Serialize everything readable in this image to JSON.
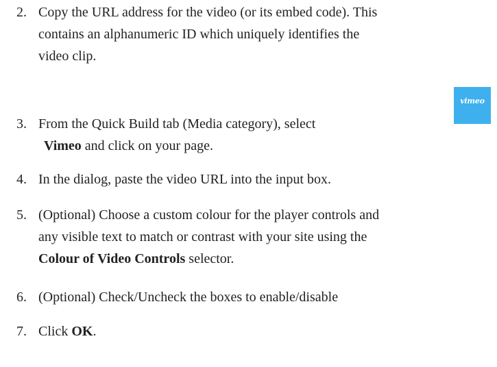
{
  "steps": [
    {
      "number": "2.",
      "lines": [
        "Copy the URL address for the video (or its embed code). This",
        "contains an alphanumeric ID which uniquely identifies the",
        "video clip."
      ]
    },
    {
      "number": "3.",
      "line1": "From the Quick Build tab (Media category), select",
      "bold": "Vimeo",
      "line2_rest": " and click on your page."
    },
    {
      "number": "4.",
      "text": "In the dialog, paste the video URL into the input box."
    },
    {
      "number": "5.",
      "line1": "(Optional) Choose a custom colour for the player controls and",
      "line2": "any visible text to match or contrast with your site using the",
      "bold": "Colour of Video Controls",
      "line3_rest": " selector."
    },
    {
      "number": "6.",
      "text": "(Optional) Check/Uncheck the boxes to enable/disable"
    },
    {
      "number": "7.",
      "prefix": "Click ",
      "bold": "OK",
      "suffix": "."
    }
  ],
  "logo": {
    "text": "vimeo",
    "color": "#3fb0ee",
    "icon": "vimeo-logo-icon"
  }
}
